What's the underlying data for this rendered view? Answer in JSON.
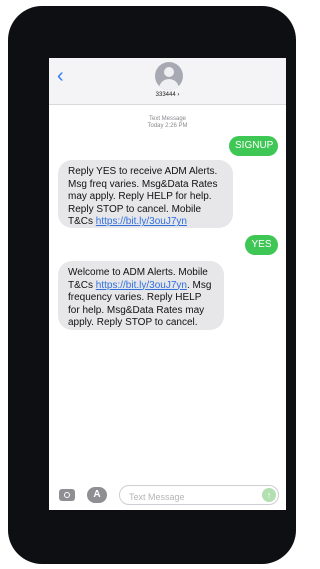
{
  "header": {
    "back_icon": "chevron-left",
    "contact": "333444 ›"
  },
  "thread": {
    "label": "Text Message",
    "timestamp": "Today 2:26 PM",
    "messages": [
      {
        "direction": "outgoing",
        "text": "SIGNUP"
      },
      {
        "direction": "incoming",
        "text_before": "Reply YES to receive ADM Alerts. Msg freq varies. Msg&Data Rates may apply. Reply HELP for help. Reply STOP to cancel. Mobile T&Cs ",
        "link": "https://bit.ly/3ouJ7yn",
        "text_after": ""
      },
      {
        "direction": "outgoing",
        "text": "YES"
      },
      {
        "direction": "incoming",
        "text_before": "Welcome to ADM Alerts. Mobile T&Cs ",
        "link": "https://bit.ly/3ouJ7yn",
        "text_after": ". Msg frequency varies. Reply HELP for help. Msg&Data Rates may apply. Reply STOP to cancel."
      }
    ]
  },
  "composer": {
    "placeholder": "Text Message",
    "camera_icon": "camera",
    "apps_icon": "app-store",
    "send_icon": "arrow-up"
  },
  "colors": {
    "outgoing": "#3ec755",
    "incoming": "#e7e7ea",
    "link": "#2f6fde",
    "accent": "#2f7df6"
  }
}
